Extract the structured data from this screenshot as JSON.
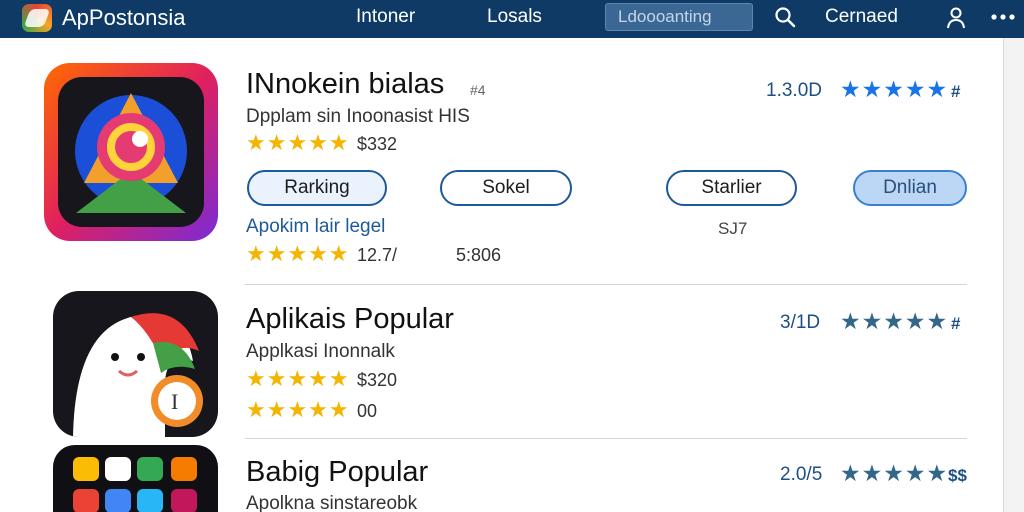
{
  "header": {
    "app_name": "ApPostonsia",
    "nav": [
      "Intoner",
      "Losals"
    ],
    "search_text": "Ldoooanting",
    "account_label": "Cernaed"
  },
  "apps": [
    {
      "title": "INnokein bialas",
      "title_suffix": "#4",
      "subtitle": "Dpplam sin Inoonasist HIS",
      "price": "$332",
      "rating": "1.3.0D",
      "rating_stars": "★★★★★",
      "hash": "#",
      "buttons": [
        "Rarking",
        "Sokel",
        "Starlier",
        "Dnlian"
      ],
      "link": "Apokim lair legel",
      "link_stat": "SJ7",
      "sub_value": "12.7/",
      "sub_value2": "5:806"
    },
    {
      "title": "Aplikais Popular",
      "subtitle": "Applkasi Inonnalk",
      "price": "$320",
      "rating": "3/1D",
      "rating_stars": "★★★★★",
      "hash": "#",
      "sub_value": "00"
    },
    {
      "title": "Babig Popular",
      "subtitle": "Apolkna sinstareobk",
      "rating": "2.0/5",
      "rating_stars": "★★★★★",
      "hash": "$$"
    }
  ],
  "colors": {
    "header_bg": "#0f3a66",
    "accent_blue": "#1a73e8",
    "star_yellow": "#f4b400"
  }
}
